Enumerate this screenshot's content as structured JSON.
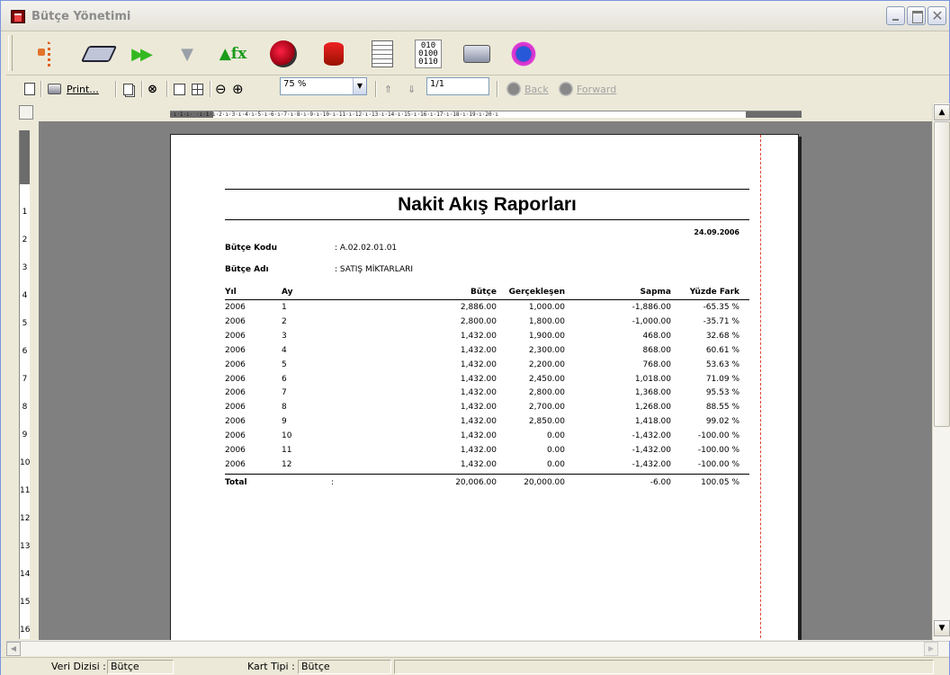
{
  "window": {
    "title": "Bütçe Yönetimi"
  },
  "toolbar": {
    "print_label": "Print...",
    "zoom_value": "75 %",
    "page_value": "1/1",
    "back_label": "Back",
    "forward_label": "Forward",
    "binary_icon_text": "010\n0100\n0110"
  },
  "ruler": {
    "h_ticks": "·ı·1·ı· ·ı·1·ı·2·ı·3·ı·4·ı·5·ı·6·ı·7·ı·8·ı·9·ı·10·ı·11·ı·12·ı·13·ı·14·ı·15·ı·16·ı·17·ı·18·ı·19·ı·20·ı",
    "v_ticks": [
      "1",
      "2",
      "3",
      "4",
      "5",
      "6",
      "7",
      "8",
      "9",
      "10",
      "11",
      "12",
      "13",
      "14",
      "15",
      "16"
    ]
  },
  "report": {
    "title": "Nakit Akış Raporları",
    "date": "24.09.2006",
    "budget_code_label": "Bütçe Kodu",
    "budget_code_value": ": A.02.02.01.01",
    "budget_name_label": "Bütçe Adı",
    "budget_name_value": ": SATIŞ MİKTARLARI",
    "columns": [
      "Yıl",
      "Ay",
      "Bütçe",
      "Gerçekleşen",
      "Sapma",
      "Yüzde Fark"
    ],
    "rows": [
      [
        "2006",
        "1",
        "2,886.00",
        "1,000.00",
        "-1,886.00",
        "-65.35 %"
      ],
      [
        "2006",
        "2",
        "2,800.00",
        "1,800.00",
        "-1,000.00",
        "-35.71 %"
      ],
      [
        "2006",
        "3",
        "1,432.00",
        "1,900.00",
        "468.00",
        "32.68 %"
      ],
      [
        "2006",
        "4",
        "1,432.00",
        "2,300.00",
        "868.00",
        "60.61 %"
      ],
      [
        "2006",
        "5",
        "1,432.00",
        "2,200.00",
        "768.00",
        "53.63 %"
      ],
      [
        "2006",
        "6",
        "1,432.00",
        "2,450.00",
        "1,018.00",
        "71.09 %"
      ],
      [
        "2006",
        "7",
        "1,432.00",
        "2,800.00",
        "1,368.00",
        "95.53 %"
      ],
      [
        "2006",
        "8",
        "1,432.00",
        "2,700.00",
        "1,268.00",
        "88.55 %"
      ],
      [
        "2006",
        "9",
        "1,432.00",
        "2,850.00",
        "1,418.00",
        "99.02 %"
      ],
      [
        "2006",
        "10",
        "1,432.00",
        "0.00",
        "-1,432.00",
        "-100.00 %"
      ],
      [
        "2006",
        "11",
        "1,432.00",
        "0.00",
        "-1,432.00",
        "-100.00 %"
      ],
      [
        "2006",
        "12",
        "1,432.00",
        "0.00",
        "-1,432.00",
        "-100.00 %"
      ]
    ],
    "total": {
      "label": "Total",
      "colon": ":",
      "budget": "20,006.00",
      "actual": "20,000.00",
      "deviation": "-6.00",
      "percent": "100.05 %"
    }
  },
  "statusbar": {
    "dataset_label": "Veri Dizisi :",
    "dataset_value": "Bütçe",
    "cardtype_label": "Kart Tipi :",
    "cardtype_value": "Bütçe"
  },
  "colors": {
    "margin_guide": "#dd4433",
    "canvas": "#808080",
    "accent_green": "#33b820"
  }
}
